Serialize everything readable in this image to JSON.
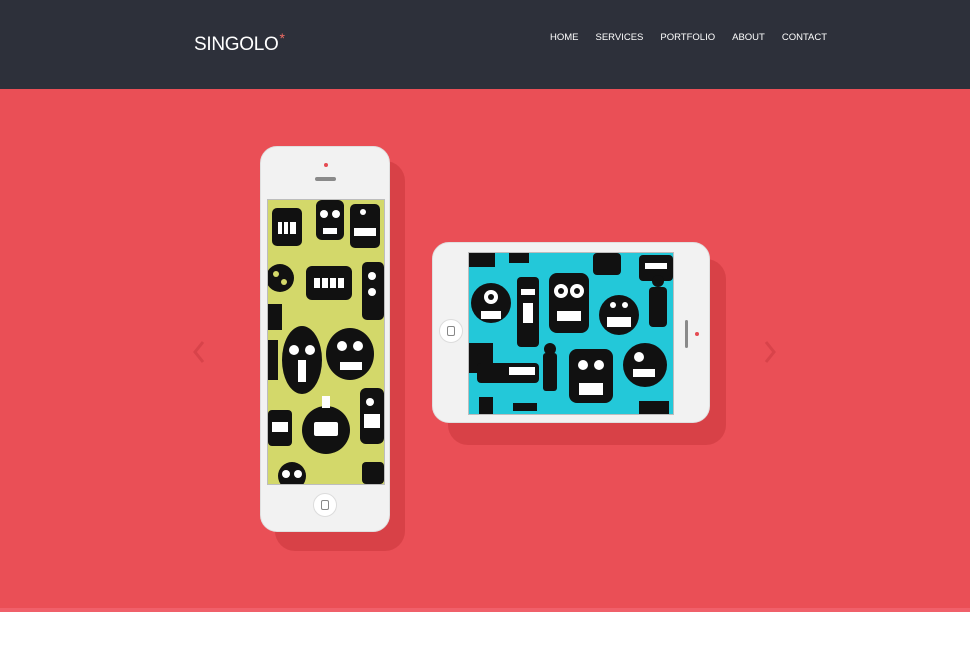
{
  "header": {
    "logo_text": "SINGOLO",
    "logo_mark": "*",
    "nav": [
      {
        "label": "HOME"
      },
      {
        "label": "SERVICES"
      },
      {
        "label": "PORTFOLIO"
      },
      {
        "label": "ABOUT"
      },
      {
        "label": "CONTACT"
      }
    ]
  },
  "slider": {
    "background_color": "#ea4f56",
    "prev_icon": "chevron-left-icon",
    "next_icon": "chevron-right-icon",
    "vertical_phone_screen_color": "#d3d86a",
    "horizontal_phone_screen_color": "#23c8d9"
  },
  "colors": {
    "header_bg": "#2d303a",
    "accent": "#f06c64"
  }
}
